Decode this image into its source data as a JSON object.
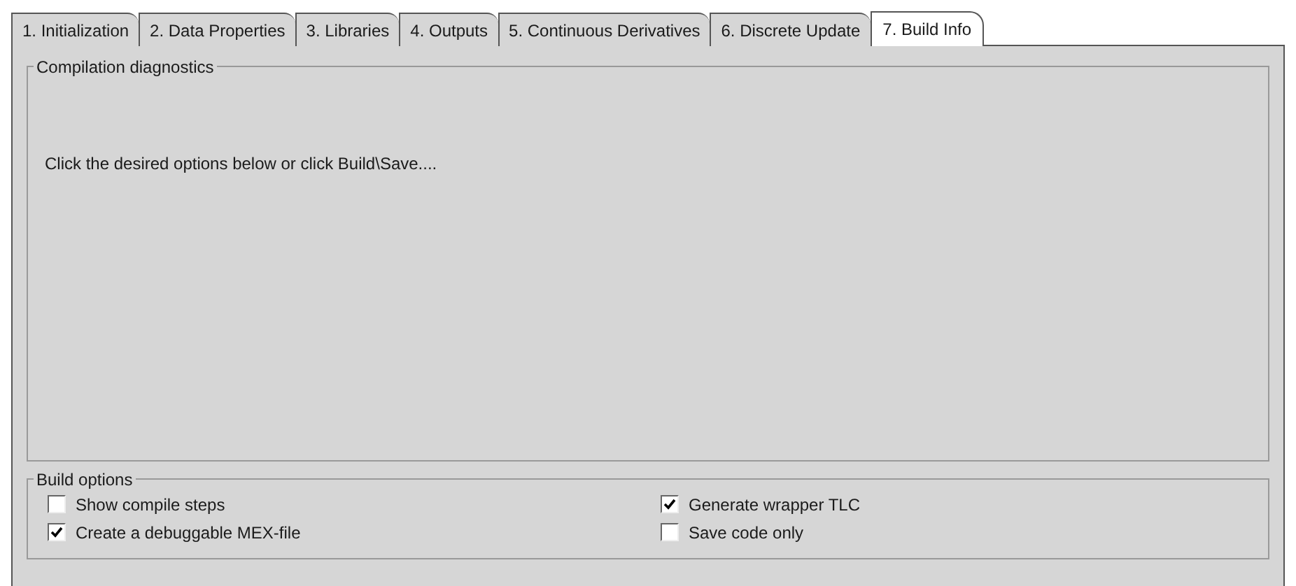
{
  "tabs": [
    {
      "label": "1. Initialization",
      "selected": false
    },
    {
      "label": "2. Data Properties",
      "selected": false
    },
    {
      "label": "3. Libraries",
      "selected": false
    },
    {
      "label": "4. Outputs",
      "selected": false
    },
    {
      "label": "5. Continuous Derivatives",
      "selected": false
    },
    {
      "label": "6. Discrete Update",
      "selected": false
    },
    {
      "label": "7. Build Info",
      "selected": true
    }
  ],
  "diagnostics": {
    "title": "Compilation diagnostics",
    "message": "Click the desired options below or click Build\\Save...."
  },
  "build_options": {
    "title": "Build options",
    "options": [
      {
        "label": "Show compile steps",
        "checked": false
      },
      {
        "label": "Generate wrapper TLC",
        "checked": true
      },
      {
        "label": "Create a debuggable MEX-file",
        "checked": true
      },
      {
        "label": "Save code only",
        "checked": false
      }
    ]
  }
}
